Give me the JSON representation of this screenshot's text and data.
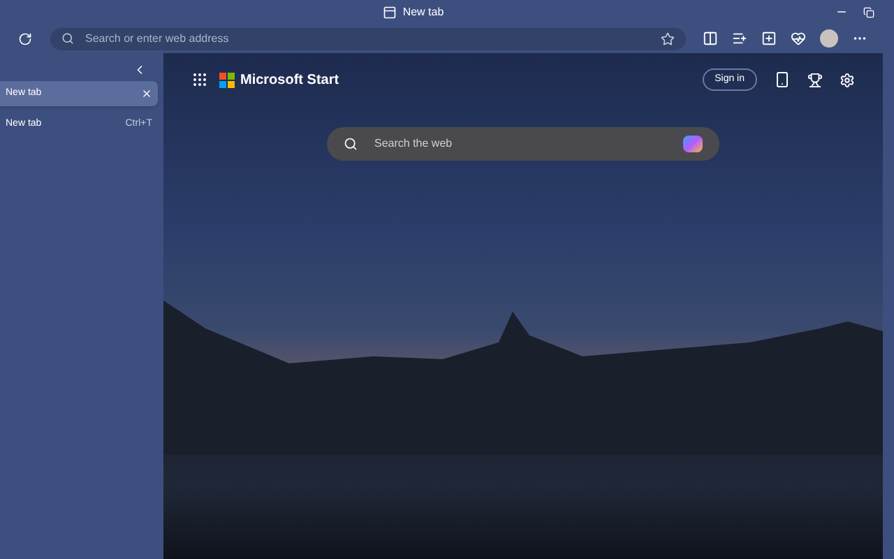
{
  "window": {
    "title": "New tab"
  },
  "address_bar": {
    "placeholder": "Search or enter web address"
  },
  "sidebar": {
    "tabs": [
      {
        "label": "New tab",
        "selected": true
      }
    ],
    "new_tab": {
      "label": "New tab",
      "shortcut": "Ctrl+T"
    }
  },
  "page": {
    "brand": "Microsoft Start",
    "sign_in": "Sign in",
    "search": {
      "placeholder": "Search the web"
    }
  }
}
